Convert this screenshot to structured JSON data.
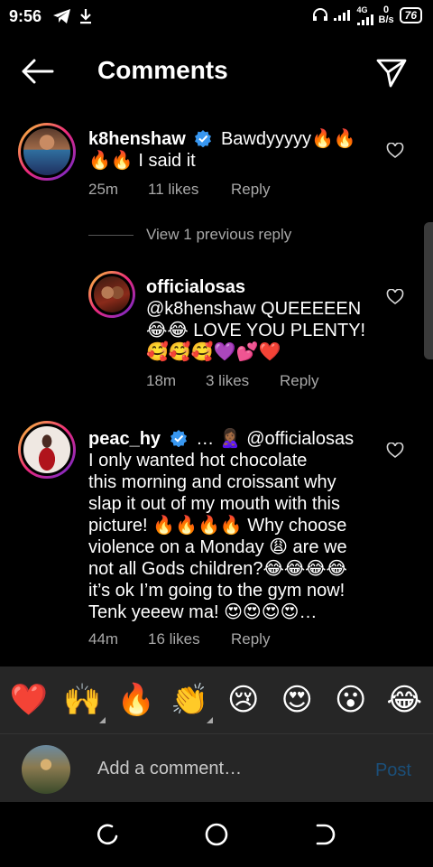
{
  "status_bar": {
    "time": "9:56",
    "network_label": "4G",
    "data_speed_value": "0",
    "data_speed_unit": "B/s",
    "battery": "76"
  },
  "header": {
    "title": "Comments"
  },
  "comments": [
    {
      "username": "k8henshaw",
      "verified": true,
      "line1": "Bawdyyyyy🔥🔥",
      "line2": "🔥🔥 I said it",
      "time": "25m",
      "likes": "11 likes",
      "reply": "Reply"
    },
    {
      "username": "officialosas",
      "verified": false,
      "line1": "@k8henshaw QUEEEEEN",
      "line2": "😂😂 LOVE YOU PLENTY!",
      "line3": "🥰🥰🥰💜💕❤️",
      "time": "18m",
      "likes": "3 likes",
      "reply": "Reply"
    },
    {
      "username": "peac_hy",
      "verified": true,
      "mention": "… 🙎🏾‍♀️ @officialosas",
      "lines": [
        "I only wanted hot chocolate",
        "this morning and croissant why",
        "slap it out of my mouth with this",
        "picture! 🔥🔥🔥🔥 Why choose",
        "violence on a Monday 😩 are we",
        "not all Gods children?😂😂😂😂",
        "it’s ok I’m going to the gym now!",
        "Tenk yeeew ma! 😍😍😍😍…"
      ],
      "time": "44m",
      "likes": "16 likes",
      "reply": "Reply"
    }
  ],
  "view_previous": "View 1 previous reply",
  "emoji_bar": [
    "❤️",
    "🙌",
    "🔥",
    "👏",
    "😢",
    "😍",
    "😮",
    "😂"
  ],
  "add_comment": {
    "placeholder": "Add a comment…",
    "post_label": "Post"
  },
  "colors": {
    "background": "#000000",
    "secondary_text": "#a8a8a8",
    "panel": "#262626",
    "post_disabled": "#1b4f79",
    "verified_blue": "#3897f0"
  },
  "icons": {
    "back": "arrow-left-icon",
    "send": "paper-plane-icon",
    "like": "heart-outline-icon",
    "verified": "verified-badge-icon"
  }
}
